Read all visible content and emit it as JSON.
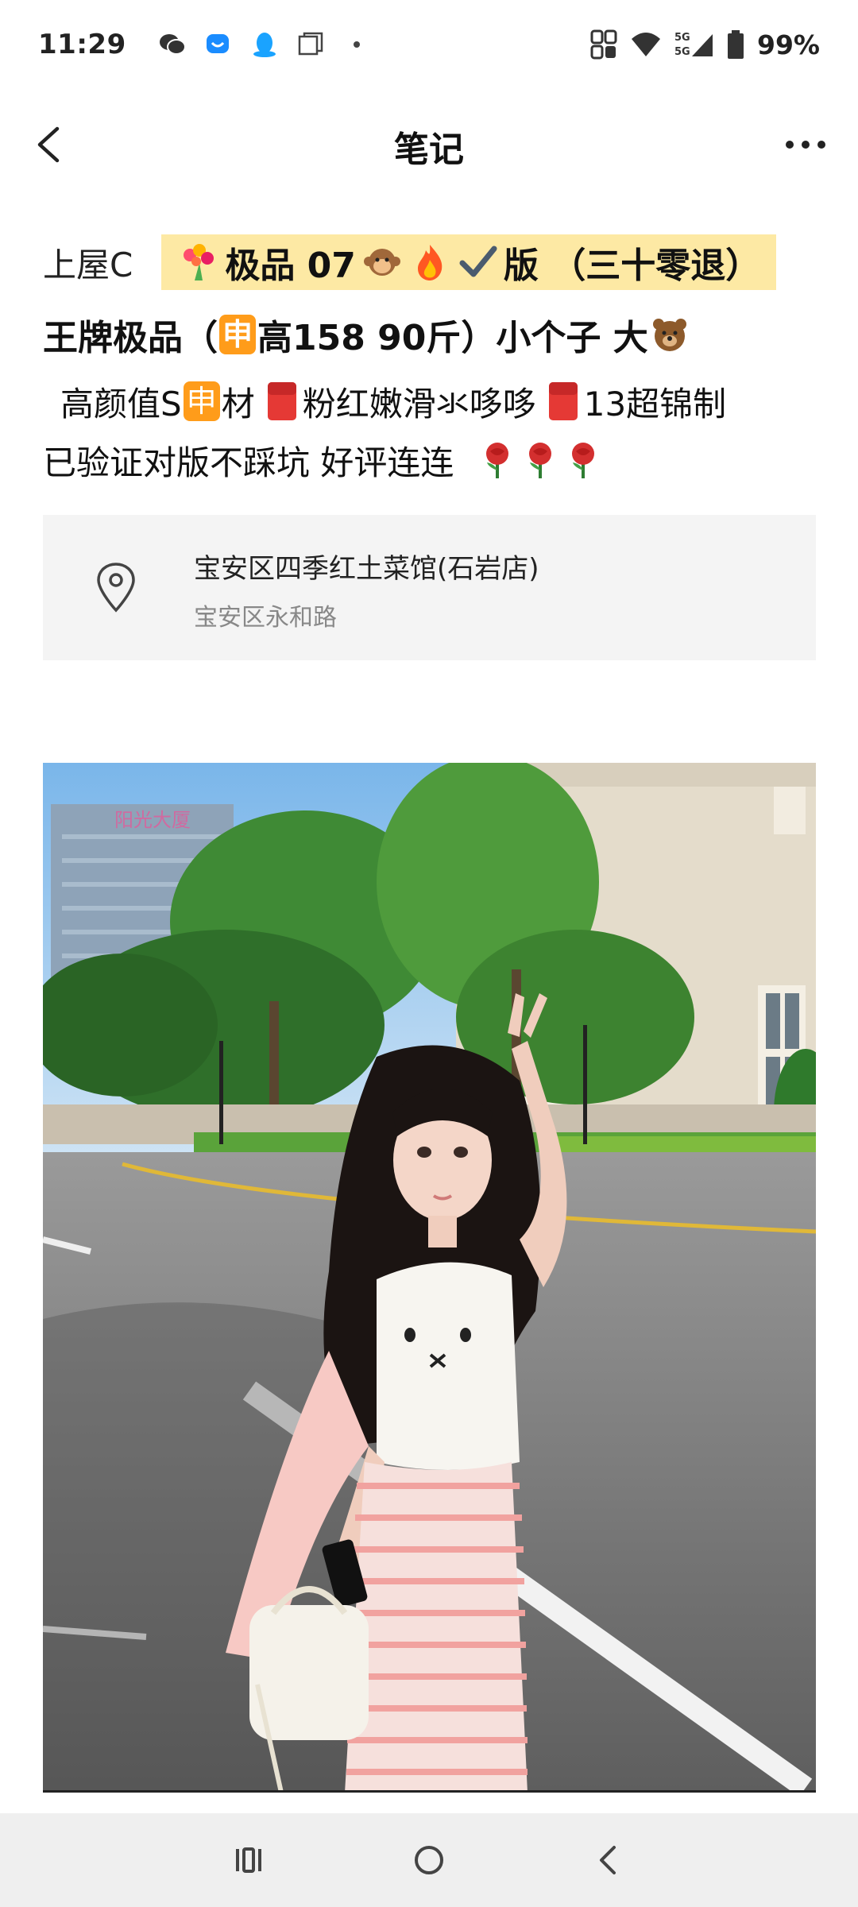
{
  "status_bar": {
    "time": "11:29",
    "notifications": [
      "wechat-icon",
      "message-icon",
      "qq-icon",
      "window-icon",
      "dot-icon"
    ],
    "network": "5G 5G",
    "battery": "99%"
  },
  "header": {
    "title": "笔记",
    "back_icon": "chevron-left-icon",
    "more_icon": "more-dots-icon"
  },
  "note": {
    "author": "上屋C",
    "highlight_parts": [
      "极品 07",
      "版 （三十零退）"
    ],
    "line2_parts": [
      "王牌极品（",
      "申",
      "高158  90斤）小个子 大"
    ],
    "line3_parts": [
      "高颜值S",
      "申",
      "材",
      "粉红嫩滑氺哆哆",
      "13超锦制"
    ],
    "line4_text": "已验证对版不踩坑  好评连连"
  },
  "location": {
    "name": "宝安区四季红土菜馆(石岩店)",
    "address": "宝安区永和路"
  },
  "photo": {
    "subject": "girl-photo",
    "building_sign": "阳光大厦"
  },
  "nav": {
    "recents_icon": "recents-icon",
    "home_icon": "home-icon",
    "back_icon": "back-icon"
  },
  "colors": {
    "highlight_bg": "#fde9a4",
    "chip_orange": "#ff9c1a",
    "card_bg": "#f4f4f4",
    "nav_bg": "#efefef"
  }
}
